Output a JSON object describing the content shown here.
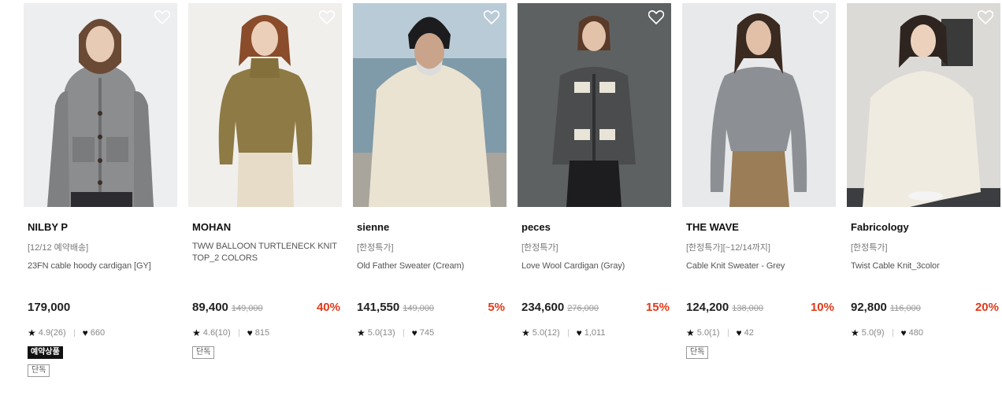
{
  "icons": {
    "wishlist": "heart-outline-icon",
    "rating": "star-icon",
    "likes": "heart-filled-icon"
  },
  "colors": {
    "discount": "#e03a1a",
    "badge_dark_bg": "#111111"
  },
  "products": [
    {
      "brand": "NILBY P",
      "tag": "[12/12 예약배송]",
      "name": "23FN cable hoody cardigan [GY]",
      "price": "179,000",
      "original_price": "",
      "discount": "",
      "rating": "4.9(26)",
      "likes": "660",
      "badges": [
        "예약상품",
        "단독"
      ]
    },
    {
      "brand": "MOHAN",
      "tag": "",
      "name": "TWW BALLOON TURTLENECK KNIT TOP_2 COLORS",
      "price": "89,400",
      "original_price": "149,000",
      "discount": "40%",
      "rating": "4.6(10)",
      "likes": "815",
      "badges": [
        "단독"
      ]
    },
    {
      "brand": "sienne",
      "tag": "[한정특가]",
      "name": "Old Father Sweater (Cream)",
      "price": "141,550",
      "original_price": "149,000",
      "discount": "5%",
      "rating": "5.0(13)",
      "likes": "745",
      "badges": []
    },
    {
      "brand": "peces",
      "tag": "[한정특가]",
      "name": "Love Wool Cardigan (Gray)",
      "price": "234,600",
      "original_price": "276,000",
      "discount": "15%",
      "rating": "5.0(12)",
      "likes": "1,011",
      "badges": []
    },
    {
      "brand": "THE WAVE",
      "tag": "[한정특가][~12/14까지]",
      "name": "Cable Knit Sweater - Grey",
      "price": "124,200",
      "original_price": "138,000",
      "discount": "10%",
      "rating": "5.0(1)",
      "likes": "42",
      "badges": [
        "단독"
      ]
    },
    {
      "brand": "Fabricology",
      "tag": "[한정특가]",
      "name": "Twist Cable Knit_3color",
      "price": "92,800",
      "original_price": "116,000",
      "discount": "20%",
      "rating": "5.0(9)",
      "likes": "480",
      "badges": []
    }
  ]
}
